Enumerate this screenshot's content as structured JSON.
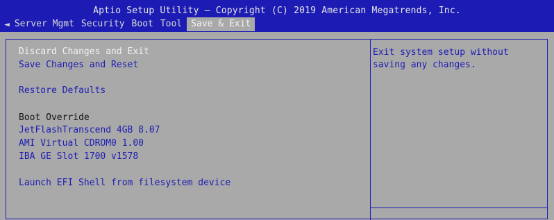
{
  "header": {
    "title": "Aptio Setup Utility – Copyright (C) 2019 American Megatrends, Inc.",
    "tabs": [
      {
        "label": "Server Mgmt"
      },
      {
        "label": "Security"
      },
      {
        "label": "Boot"
      },
      {
        "label": "Tool"
      },
      {
        "label": "Save & Exit"
      }
    ],
    "active_tab": "Save & Exit",
    "left_arrow": "◄"
  },
  "menu": {
    "items": [
      {
        "label": "Discard Changes and Exit"
      },
      {
        "label": "Save Changes and Reset"
      },
      {
        "label": "Restore Defaults"
      },
      {
        "label": "Boot Override"
      },
      {
        "label": "JetFlashTranscend 4GB 8.07"
      },
      {
        "label": "AMI Virtual CDROM0 1.00"
      },
      {
        "label": "IBA GE Slot 1700 v1578"
      },
      {
        "label": "Launch EFI Shell from filesystem device"
      }
    ]
  },
  "help": {
    "text": "Exit system setup without saving any changes."
  },
  "colors": {
    "background": "#a9a9a9",
    "accent": "#1c1cb4",
    "selected_text": "#f2f2f2"
  }
}
